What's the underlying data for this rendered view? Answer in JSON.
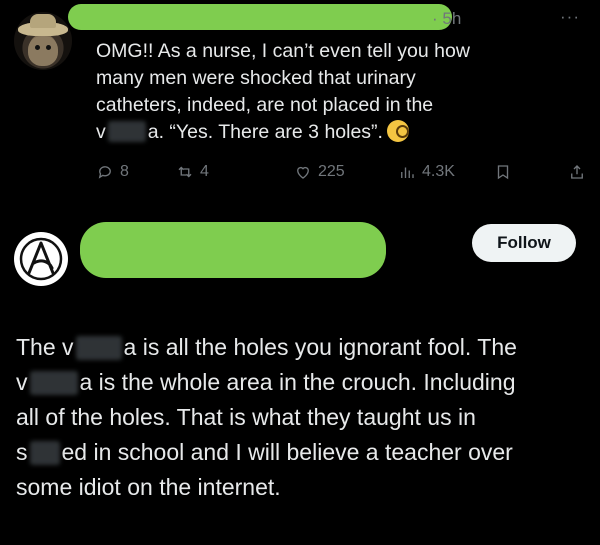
{
  "tweet1": {
    "timestamp": "5h",
    "more_label": "···",
    "lines": [
      {
        "pre": "OMG!! As a nurse, I can’t even tell you how",
        "post": ""
      },
      {
        "pre": "many men were shocked that urinary",
        "post": ""
      },
      {
        "pre": "catheters, indeed, are not placed in the",
        "post": ""
      },
      {
        "pre": "v",
        "post": "a. “Yes. There are 3 holes”."
      }
    ],
    "actions": {
      "replies": "8",
      "reposts": "4",
      "likes": "225",
      "views": "4.3K"
    }
  },
  "tweet2": {
    "follow_label": "Follow",
    "lines": [
      {
        "pre": "The v",
        "post": "a is all the holes you ignorant fool. The"
      },
      {
        "pre": "v",
        "post": "a is the whole area in the crouch. Including"
      },
      {
        "pre": "all of the holes. That is what they taught us in",
        "post": ""
      },
      {
        "pre": "s",
        "post": "ed in school and I will believe a teacher over"
      },
      {
        "pre": "some idiot on the internet.",
        "post": ""
      }
    ]
  },
  "colors": {
    "background": "#000000",
    "text": "#e7e9ea",
    "muted": "#71767b",
    "redaction_green": "#7fcd4f"
  }
}
